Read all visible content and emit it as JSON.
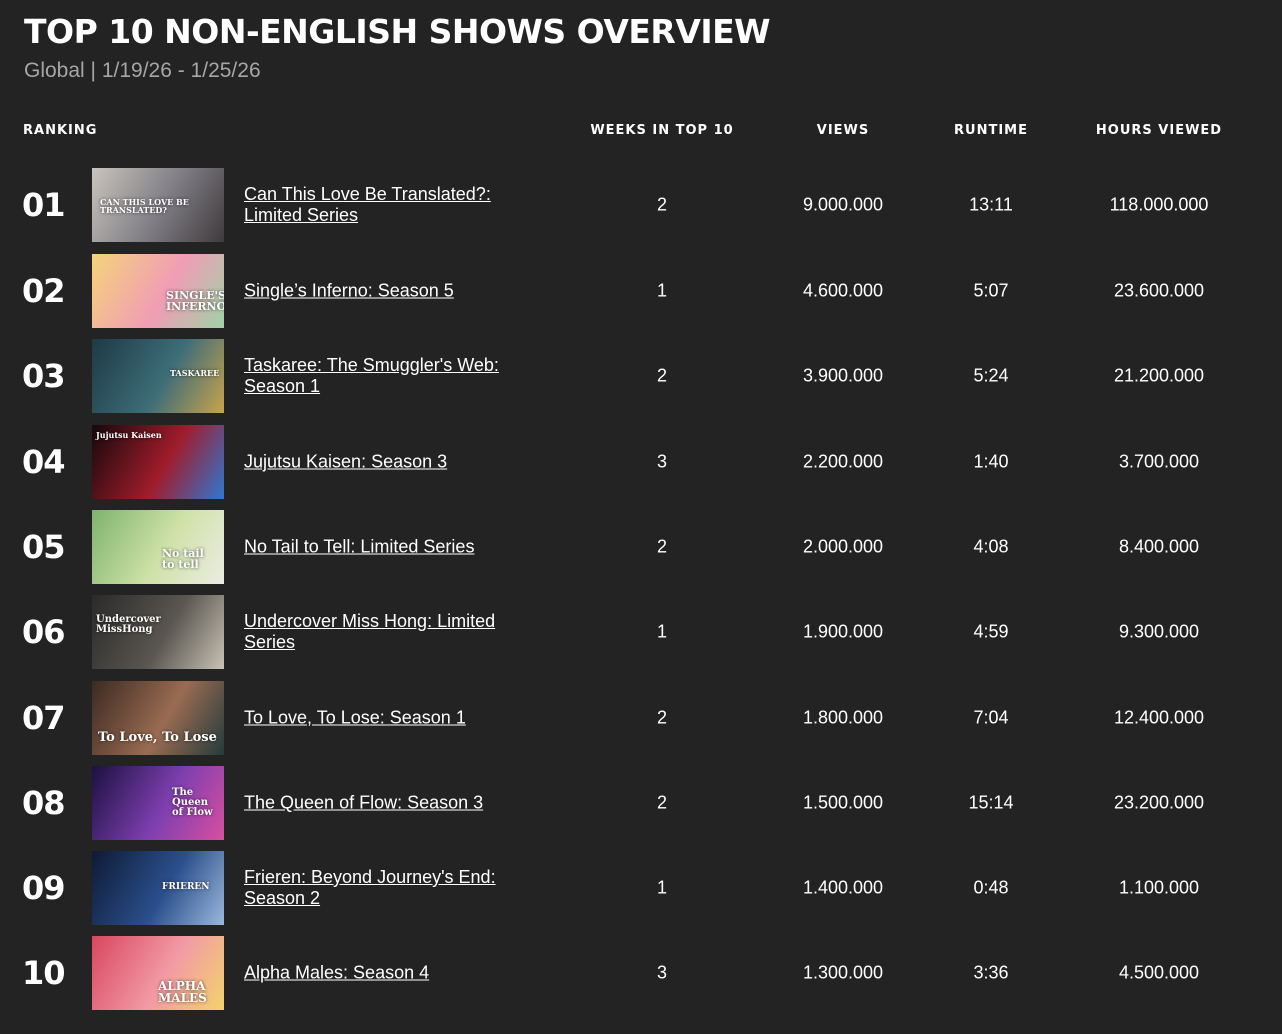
{
  "header": {
    "title": "TOP 10 NON-ENGLISH SHOWS OVERVIEW",
    "subtitle": "Global | 1/19/26 - 1/25/26"
  },
  "columns": {
    "ranking": "RANKING",
    "weeks": "WEEKS IN TOP 10",
    "views": "VIEWS",
    "runtime": "RUNTIME",
    "hours": "HOURS VIEWED"
  },
  "rows": [
    {
      "rank": "01",
      "title": "Can This Love Be Translated?: Limited Series",
      "weeks": "2",
      "views": "9.000.000",
      "runtime": "13:11",
      "hours": "118.000.000",
      "thumb_colors": [
        "#c9c4bd",
        "#7d7b82",
        "#3f3a3c"
      ]
    },
    {
      "rank": "02",
      "title": "Single’s Inferno: Season 5",
      "weeks": "1",
      "views": "4.600.000",
      "runtime": "5:07",
      "hours": "23.600.000",
      "thumb_colors": [
        "#f5d37a",
        "#f09db5",
        "#9fd3a8"
      ]
    },
    {
      "rank": "03",
      "title": "Taskaree: The Smuggler's Web: Season 1",
      "weeks": "2",
      "views": "3.900.000",
      "runtime": "5:24",
      "hours": "21.200.000",
      "thumb_colors": [
        "#1c3a46",
        "#3e6d78",
        "#c9a44b"
      ]
    },
    {
      "rank": "04",
      "title": "Jujutsu Kaisen: Season 3",
      "weeks": "3",
      "views": "2.200.000",
      "runtime": "1:40",
      "hours": "3.700.000",
      "thumb_colors": [
        "#14090c",
        "#a01c2b",
        "#2e78d1"
      ]
    },
    {
      "rank": "05",
      "title": "No Tail to Tell: Limited Series",
      "weeks": "2",
      "views": "2.000.000",
      "runtime": "4:08",
      "hours": "8.400.000",
      "thumb_colors": [
        "#7fb36d",
        "#cfe2a8",
        "#ecece2"
      ]
    },
    {
      "rank": "06",
      "title": "Undercover Miss Hong: Limited Series",
      "weeks": "1",
      "views": "1.900.000",
      "runtime": "4:59",
      "hours": "9.300.000",
      "thumb_colors": [
        "#2a2a2a",
        "#5a5650",
        "#c9c3b5"
      ]
    },
    {
      "rank": "07",
      "title": "To Love, To Lose: Season 1",
      "weeks": "2",
      "views": "1.800.000",
      "runtime": "7:04",
      "hours": "12.400.000",
      "thumb_colors": [
        "#3b2a22",
        "#9a6b52",
        "#243b3c"
      ]
    },
    {
      "rank": "08",
      "title": "The Queen of Flow: Season 3",
      "weeks": "2",
      "views": "1.500.000",
      "runtime": "15:14",
      "hours": "23.200.000",
      "thumb_colors": [
        "#1b1140",
        "#7e3fb0",
        "#d94fa0"
      ]
    },
    {
      "rank": "09",
      "title": "Frieren: Beyond Journey's End: Season 2",
      "weeks": "1",
      "views": "1.400.000",
      "runtime": "0:48",
      "hours": "1.100.000",
      "thumb_colors": [
        "#0e1a35",
        "#2b4f8c",
        "#9bb8dc"
      ]
    },
    {
      "rank": "10",
      "title": "Alpha Males: Season 4",
      "weeks": "3",
      "views": "1.300.000",
      "runtime": "3:36",
      "hours": "4.500.000",
      "thumb_colors": [
        "#d9475e",
        "#f29aa6",
        "#f3d36b"
      ]
    }
  ],
  "thumb_text": [
    "CAN THIS LOVE BE TRANSLATED?",
    "SINGLE'S INFERNO",
    "TASKAREE",
    "Jujutsu Kaisen",
    "No tail to tell",
    "Undercover MissHong",
    "To Love, To Lose",
    "The Queen of Flow",
    "FRIEREN",
    "ALPHA MALES"
  ],
  "colors": {
    "background": "#232323",
    "text": "#ffffff",
    "subtitle": "#a6a6a6"
  }
}
